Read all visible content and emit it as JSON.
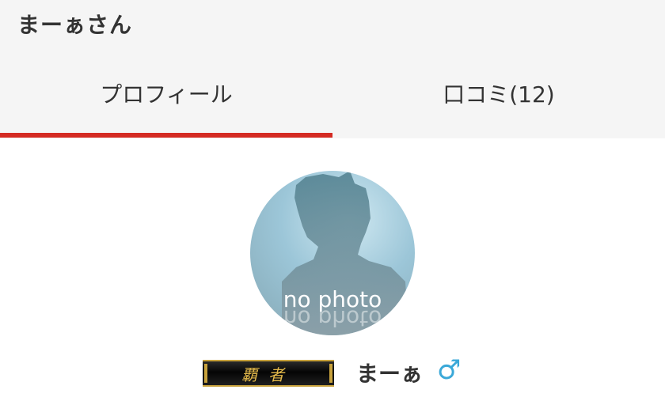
{
  "header": {
    "title": "まーぁさん"
  },
  "tabs": [
    {
      "label": "プロフィール",
      "active": true
    },
    {
      "label": "口コミ(12)",
      "active": false
    }
  ],
  "profile": {
    "avatar_text": "no photo",
    "badge": "覇者",
    "name": "まーぁ",
    "gender_icon": "male-icon"
  },
  "colors": {
    "accent": "#d42b23",
    "gender": "#3aa8d8"
  }
}
